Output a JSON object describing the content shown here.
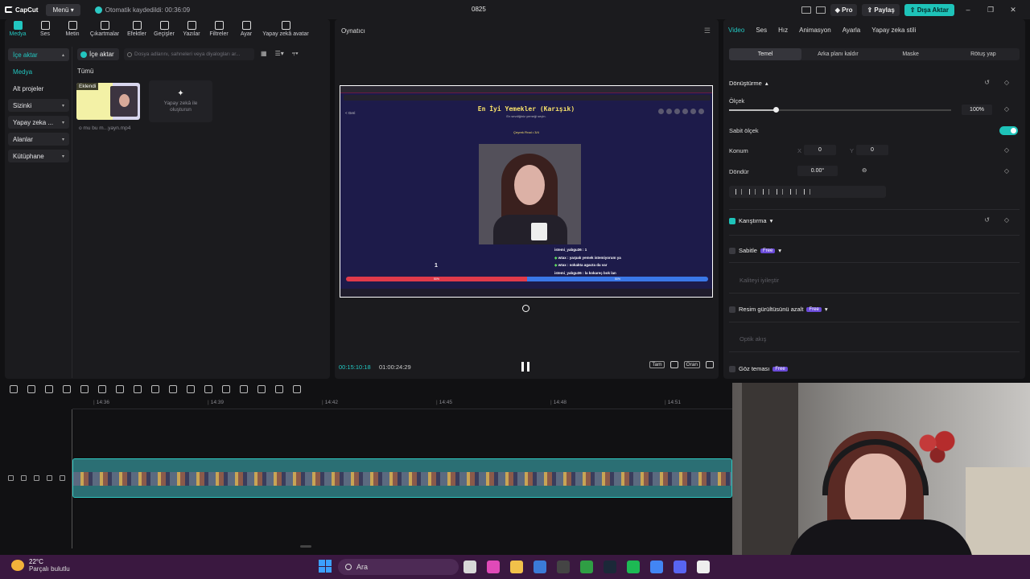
{
  "titlebar": {
    "app": "CapCut",
    "menu_label": "Menü",
    "autosave": "Otomatik kaydedildi: 00:36:09",
    "project": "0825",
    "pro_label": "Pro",
    "share_label": "Paylaş",
    "export_label": "Dışa Aktar"
  },
  "tools": [
    {
      "label": "Medya",
      "icon": "media-icon"
    },
    {
      "label": "Ses",
      "icon": "audio-icon"
    },
    {
      "label": "Metin",
      "icon": "text-icon"
    },
    {
      "label": "Çıkartmalar",
      "icon": "sticker-icon"
    },
    {
      "label": "Efektler",
      "icon": "effects-icon"
    },
    {
      "label": "Geçişler",
      "icon": "transition-icon"
    },
    {
      "label": "Yazılar",
      "icon": "captions-icon"
    },
    {
      "label": "Filtreler",
      "icon": "filter-icon"
    },
    {
      "label": "Ayar",
      "icon": "adjust-icon"
    },
    {
      "label": "Yapay zekâ avatar",
      "icon": "ai-avatar-icon"
    }
  ],
  "sidebar": {
    "items": [
      "İçe aktar",
      "Medya",
      "Alt projeler",
      "Sizinki",
      "Yapay zeka ...",
      "Alanlar",
      "Kütüphane"
    ]
  },
  "media": {
    "import_label": "İçe aktar",
    "search_placeholder": "Dosya adlarını, sahneleri veya diyalogları ar...",
    "all_label": "Tümü",
    "thumb_tag": "Eklendi",
    "file_name": "o mu bu m...yayn.mp4",
    "ai_card_label": "Yapay zekâ ile oluşturun"
  },
  "player": {
    "title": "Oynatıcı",
    "timecode": "00:15:10:18",
    "duration": "01:00:24:29",
    "btn_full": "Tam",
    "btn_ratio": "Oran",
    "preview": {
      "heading": "En İyi Yemekler (Karışık)",
      "subheading": "En sevdiğiniz yemeği seçin.",
      "back": "< Geri",
      "round": "Çeyrek Final • 3/4",
      "chat": [
        {
          "user": "istemi_yabgu36",
          "msg": "1"
        },
        {
          "user": "wtax",
          "msg": "yarpak yemek istemiyorum ya"
        },
        {
          "user": "wtax",
          "msg": "sokakta agacta da var"
        },
        {
          "user": "istemi_yabgu36",
          "msg": "la kokareç bok lan"
        }
      ],
      "left_number": "1",
      "bar_left": "50%",
      "bar_right": "50%"
    }
  },
  "properties": {
    "tabs": [
      "Video",
      "Ses",
      "Hız",
      "Animasyon",
      "Ayarla",
      "Yapay zeka stili"
    ],
    "subtabs": [
      "Temel",
      "Arka planı kaldır",
      "Maske",
      "Rötuş yap"
    ],
    "transform_title": "Dönüştürme",
    "scale_label": "Ölçek",
    "scale_value": "100%",
    "scale_fraction": 0.21,
    "fixed_scale_label": "Sabit ölçek",
    "position_label": "Konum",
    "pos_x_label": "X",
    "pos_x": "0",
    "pos_y_label": "Y",
    "pos_y": "0",
    "rotate_label": "Döndür",
    "rotate_value": "0.00°",
    "blend_label": "Karıştırma",
    "stabilize_label": "Sabitle",
    "quality_label": "Kaliteyi iyileştir",
    "denoise_label": "Resim gürültüsünü azalt",
    "optical_label": "Optik akış",
    "eye_label": "Göz teması",
    "free_badge": "Free"
  },
  "timeline": {
    "ticks": [
      "14:36",
      "14:39",
      "14:42",
      "14:45",
      "14:48",
      "14:51"
    ]
  },
  "taskbar": {
    "temperature": "22°C",
    "weather": "Parçalı bulutlu",
    "search_label": "Ara"
  },
  "colors": {
    "accent": "#1ec3b9",
    "taskbar": "#3a1840"
  }
}
